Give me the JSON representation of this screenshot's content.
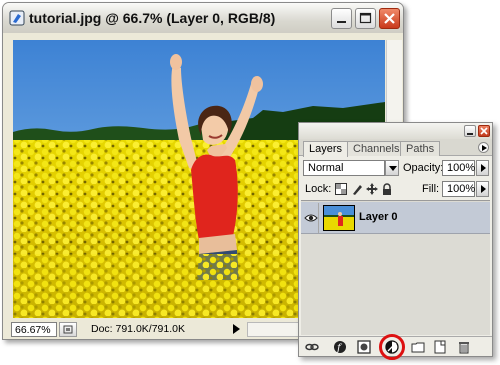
{
  "document": {
    "title": "tutorial.jpg @ 66.7% (Layer 0, RGB/8)",
    "zoom": "66.67%",
    "doc_size": "Doc: 791.0K/791.0K"
  },
  "layers_panel": {
    "tabs": [
      "Layers",
      "Channels",
      "Paths"
    ],
    "active_tab": "Layers",
    "blend_mode": "Normal",
    "opacity_label": "Opacity:",
    "opacity_value": "100%",
    "lock_label": "Lock:",
    "fill_label": "Fill:",
    "fill_value": "100%",
    "layers": [
      {
        "name": "Layer 0",
        "visible": true,
        "selected": true
      }
    ],
    "bottom_icons": [
      "link-layers-icon",
      "layer-style-icon",
      "layer-mask-icon",
      "adjustment-layer-icon",
      "layer-group-icon",
      "new-layer-icon",
      "delete-layer-icon"
    ],
    "highlighted_icon": "adjustment-layer-icon"
  },
  "colors": {
    "field_yellow": "#f3e400",
    "sky_blue": "#4a8fd8",
    "shirt_red": "#e2231a",
    "highlight_circle": "#dd1111",
    "selected_layer": "#c3cad6"
  }
}
